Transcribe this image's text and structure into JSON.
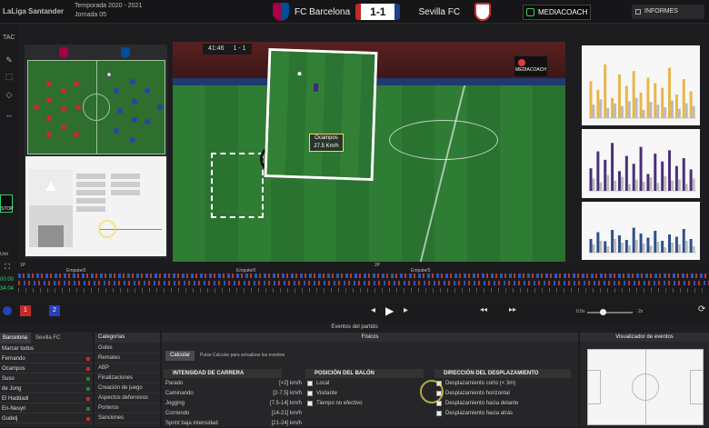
{
  "topbar": {
    "league": "LaLiga Santander",
    "season": "Temporada 2020 - 2021",
    "round": "Jornada 05",
    "home_team": "FC Barcelona",
    "away_team": "Sevilla FC",
    "score": "1-1",
    "mediacoach": "MEDIACOACH",
    "informes": "INFORMES"
  },
  "sidebar": {
    "tac": "TAC",
    "stop": "STOP",
    "unit": "Unit"
  },
  "video": {
    "clock": "41:46",
    "score": "1 - 1",
    "badge_text": "MEDIACOACH",
    "inset_player": "Ocampos",
    "inset_speed": "27.5 Km/h"
  },
  "timeline": {
    "p1": "1P",
    "p2": "2P",
    "time_a": "00:00",
    "time_b": "34:04",
    "label_a": "Empate/0",
    "label_b": "Empate/0",
    "label_c": "Empate/0",
    "speed_left": "0.5x",
    "speed_right": "2x"
  },
  "controls": {
    "count_a": "1",
    "count_b": "2"
  },
  "events": {
    "title": "Eventos del partido"
  },
  "teams": {
    "home_tab": "Barcelona",
    "away_tab": "Sevilla FC",
    "select_all": "Marcar todos",
    "players": [
      "Fernando",
      "Ocampos",
      "Suso",
      "de Jong",
      "El Haddadi",
      "En-Nesyri",
      "Gudelj"
    ]
  },
  "categories": {
    "header": "Categorías",
    "items": [
      "Goles",
      "Remates",
      "ABP",
      "Finalizaciones",
      "Creación de juego",
      "Aspectos defensivos",
      "Porteros",
      "Sanciones"
    ]
  },
  "fisicos": {
    "header": "Físicos",
    "calc_button": "Calcular",
    "calc_hint": "Pulse Calcular para actualizar los eventos",
    "col1_title": "INTENSIDAD DE CARRERA",
    "col1_rows": [
      {
        "label": "Parado",
        "range": "[<2] km/h"
      },
      {
        "label": "Caminando",
        "range": "[2-7.5] km/h"
      },
      {
        "label": "Jogging",
        "range": "[7.5-14] km/h"
      },
      {
        "label": "Corriendo",
        "range": "[14-21] km/h"
      },
      {
        "label": "Sprint baja intensidad",
        "range": "[21-24] km/h"
      }
    ],
    "col2_title": "POSICIÓN DEL BALÓN",
    "col2_rows": [
      "Local",
      "Visitante",
      "Tiempo no efectivo"
    ],
    "col3_title": "DIRECCIÓN DEL DESPLAZAMIENTO",
    "col3_rows": [
      "Desplazamiento corto (< 3m)",
      "Desplazamiento horizontal",
      "Desplazamiento hacia delante",
      "Desplazamiento hacia atrás"
    ]
  },
  "visualizer": {
    "title": "Visualizador de eventos"
  },
  "chart_data": [
    {
      "type": "bar",
      "series": [
        {
          "values": [
            55,
            42,
            80,
            30,
            65,
            48,
            70,
            38,
            60,
            52,
            45,
            75,
            35,
            58,
            40
          ]
        },
        {
          "values": [
            20,
            28,
            15,
            22,
            18,
            25,
            30,
            12,
            24,
            20,
            16,
            26,
            14,
            22,
            18
          ]
        }
      ]
    },
    {
      "type": "bar",
      "series": [
        {
          "values": [
            40,
            70,
            55,
            85,
            35,
            62,
            48,
            78,
            30,
            66,
            52,
            72,
            44,
            58,
            38
          ]
        },
        {
          "values": [
            22,
            15,
            28,
            18,
            25,
            12,
            20,
            16,
            24,
            14,
            26,
            18,
            20,
            12,
            22
          ]
        }
      ]
    },
    {
      "type": "bar",
      "series": [
        {
          "values": [
            30,
            45,
            25,
            50,
            38,
            28,
            55,
            42,
            33,
            48,
            26,
            40,
            35,
            52,
            30
          ]
        },
        {
          "values": [
            18,
            26,
            14,
            30,
            22,
            16,
            28,
            20,
            15,
            24,
            12,
            22,
            18,
            26,
            14
          ]
        }
      ]
    }
  ],
  "colors": {
    "accent_green": "#2fd06b",
    "highlight_yellow": "#f0e050",
    "bar_gold": "#e8b64a",
    "bar_purple": "#4a2f7a",
    "bar_blue": "#2e4f8c"
  }
}
